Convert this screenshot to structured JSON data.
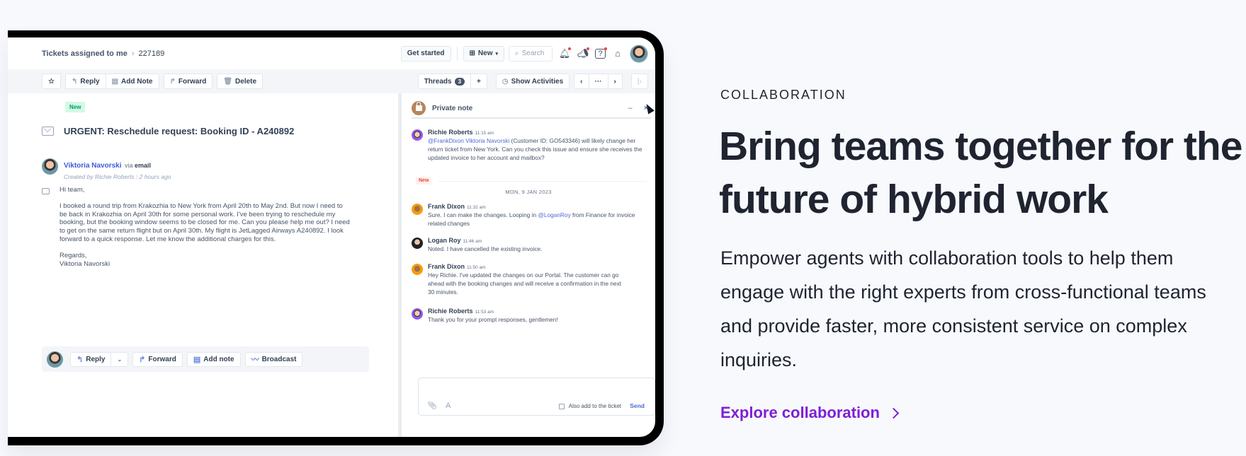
{
  "app": {
    "breadcrumb": {
      "parent": "Tickets assigned to me",
      "separator": "›",
      "ticket_id": "227189"
    },
    "header": {
      "get_started": "Get started",
      "new_label": "New",
      "search_placeholder": "Search",
      "icons": [
        "bell-icon",
        "megaphone-icon",
        "help-icon",
        "store-icon"
      ]
    },
    "toolbar": {
      "reply": "Reply",
      "add_note": "Add Note",
      "forward": "Forward",
      "delete": "Delete",
      "threads": "Threads",
      "threads_count": "3",
      "add": "+",
      "show_activities": "Show Activities",
      "prev": "‹",
      "more": "···",
      "next": "›",
      "collapse": "|›"
    },
    "ticket": {
      "status": "New",
      "subject": "URGENT: Reschedule request: Booking ID - A240892",
      "sender": "Viktoria Navorski",
      "via": "via",
      "channel": "email",
      "created_by": "Created by Richie Roberts",
      "created_ago": "2 hours ago",
      "body": [
        "Hi team,",
        "I booked a round trip from Krakozhia to New York from April 20th to May 2nd. But now I need to be  back in Krakozhia on April 30th for some personal work. I've been trying to reschedule my booking,  but the booking window seems to be closed for me. Can you please help me out? I need to get on  the same return flight but on April 30th. My flight is JetLagged Airways A240892.   I look forward to a quick response. Let me know the additional charges for this.",
        "Regards,",
        "Viktoria Navorski"
      ]
    },
    "reply_bar": {
      "reply": "Reply",
      "forward": "Forward",
      "add_note": "Add note",
      "broadcast": "Broadcast"
    },
    "private_note": {
      "title": "Private note",
      "minimize": "–",
      "close": "×",
      "new_tag": "New",
      "date_separator": "MON, 9 JAN 2023",
      "messages": [
        {
          "name": "Richie Roberts",
          "time": "11:15 am",
          "mention": "@FrankDixon Viktoria Navorski",
          "text": " (Customer ID: GO543346) will likely change her return ticket from New York. Can you check this issue and ensure she receives the updated invoice to her account and mailbox?"
        },
        {
          "name": "Frank Dixon",
          "time": "11:32 am",
          "text_before": "Sure. I can make the changes. Looping in ",
          "mention": "@LoganRoy",
          "text_after": " from Finance for invoice related changes"
        },
        {
          "name": "Logan Roy",
          "time": "11:46 am",
          "text": "Noted. I have cancelled the existing invoice."
        },
        {
          "name": "Frank Dixon",
          "time": "11:50 am",
          "text": "Hey Richie. I've updated the changes on our Portal. The customer can go ahead with the booking changes and will receive a confirmation in the next 30 minutes."
        },
        {
          "name": "Richie Roberts",
          "time": "11:53 am",
          "text": "Thank you for your prompt responses, gentlemen!"
        }
      ],
      "composer": {
        "also_add": "Also add to the ticket",
        "also_add_checked": false,
        "send": "Send"
      }
    }
  },
  "marketing": {
    "eyebrow": "COLLABORATION",
    "headline": "Bring teams together for the future of hybrid work",
    "description": "Empower agents with collaboration tools to help them engage with the right experts from cross-functional teams and provide faster, more consistent service on complex inquiries.",
    "cta": "Explore collaboration",
    "accent_color": "#7e1fd6"
  }
}
